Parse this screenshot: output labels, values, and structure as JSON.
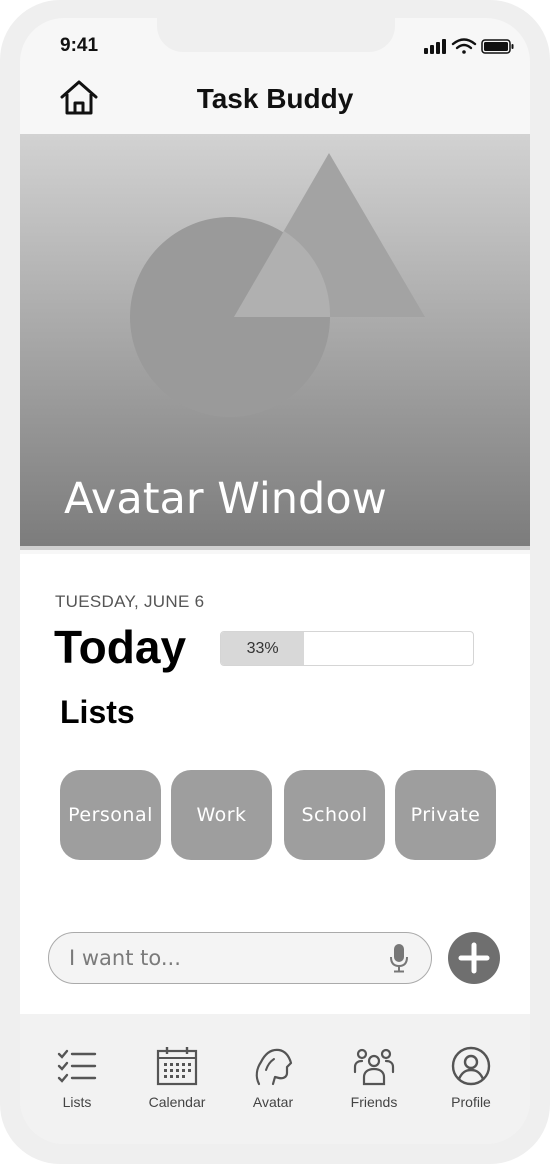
{
  "status_bar": {
    "time": "9:41"
  },
  "header": {
    "title": "Task Buddy",
    "home_icon": "home-icon"
  },
  "avatar_window": {
    "title": "Avatar Window"
  },
  "today": {
    "date": "TUESDAY, JUNE 6",
    "heading": "Today",
    "progress_fraction": 0.33,
    "progress_label": "33%"
  },
  "lists": {
    "heading": "Lists",
    "items": [
      {
        "label": "Personal"
      },
      {
        "label": "Work"
      },
      {
        "label": "School"
      },
      {
        "label": "Private"
      }
    ]
  },
  "task_input": {
    "placeholder": "I want to...",
    "mic_icon": "microphone-icon",
    "add_icon": "plus-icon"
  },
  "tabbar": {
    "tabs": [
      {
        "label": "Lists",
        "icon": "list-icon"
      },
      {
        "label": "Calendar",
        "icon": "calendar-icon"
      },
      {
        "label": "Avatar",
        "icon": "avatar-icon"
      },
      {
        "label": "Friends",
        "icon": "friends-icon"
      },
      {
        "label": "Profile",
        "icon": "profile-icon"
      }
    ]
  },
  "colors": {
    "list_button": "#9e9e9e",
    "add_button": "#6f6f6f",
    "avatar_gradient_top": "#d2d2d2",
    "avatar_gradient_bottom": "#7c7c7c"
  }
}
